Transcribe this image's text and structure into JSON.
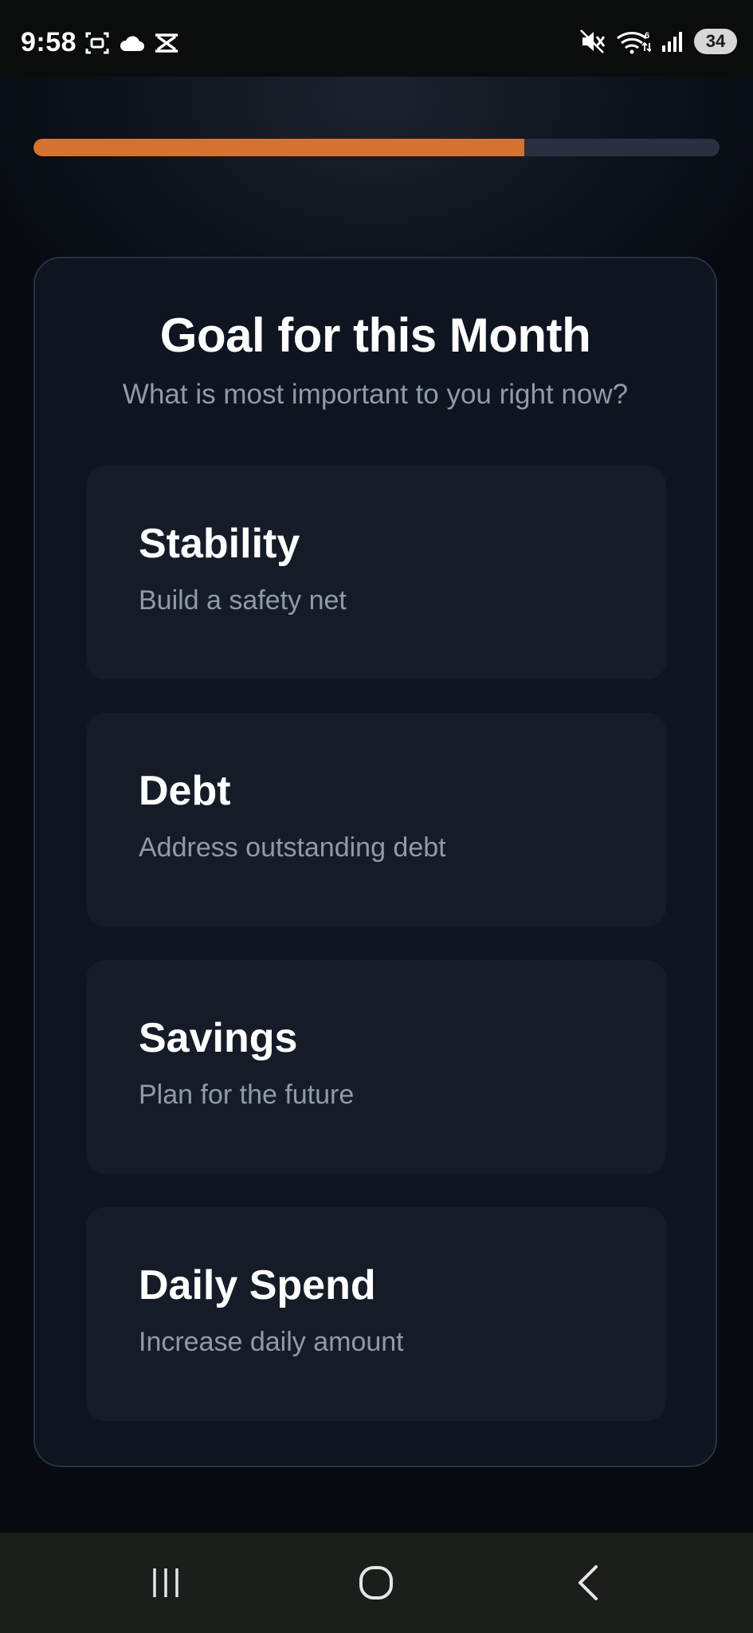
{
  "status_bar": {
    "time": "9:58",
    "battery": "34",
    "left_icons": [
      "screenshot-icon",
      "cloud-icon",
      "capcut-icon"
    ],
    "right_icons": [
      "mute-icon",
      "wifi-icon",
      "signal-icon"
    ]
  },
  "progress": {
    "fraction": 0.715,
    "color": "#d4722f"
  },
  "card": {
    "title": "Goal for this Month",
    "subtitle": "What is most important to you right now?",
    "options": [
      {
        "title": "Stability",
        "description": "Build a safety net"
      },
      {
        "title": "Debt",
        "description": "Address outstanding debt"
      },
      {
        "title": "Savings",
        "description": "Plan for the future"
      },
      {
        "title": "Daily Spend",
        "description": "Increase daily amount"
      }
    ]
  },
  "nav_bar": {
    "buttons": [
      "recent-apps-icon",
      "home-icon",
      "back-icon"
    ]
  }
}
